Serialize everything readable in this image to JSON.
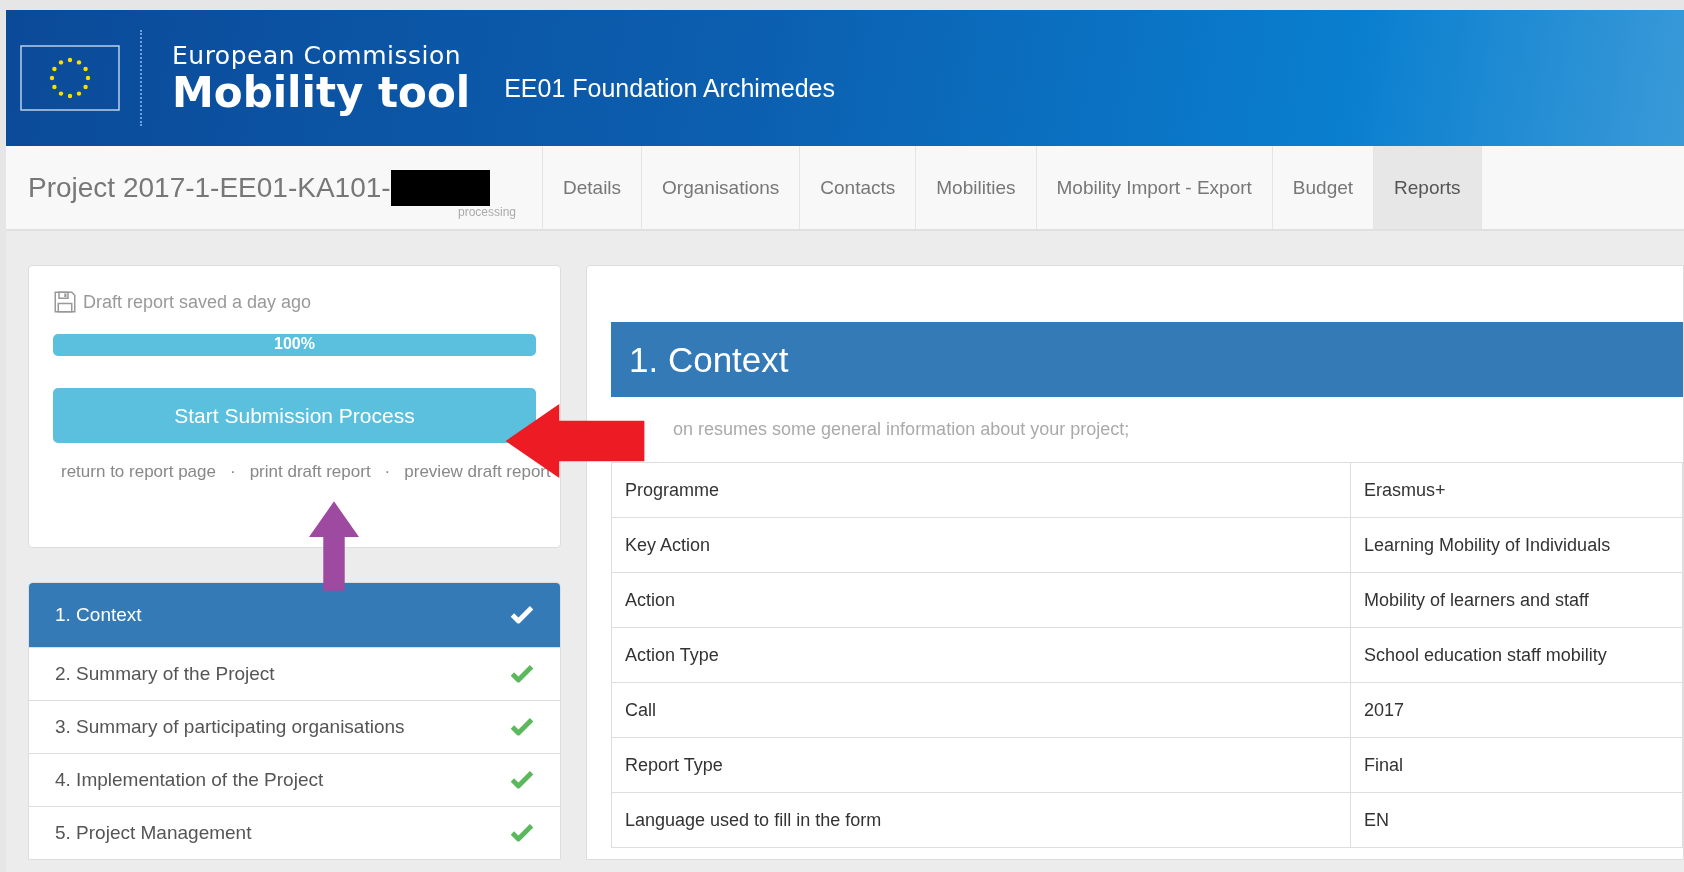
{
  "header": {
    "org_line": "European Commission",
    "app_name": "Mobility tool",
    "organisation": "EE01 Foundation Archimedes"
  },
  "project": {
    "title": "Project 2017-1-EE01-KA101-",
    "status": "processing"
  },
  "tabs": [
    {
      "label": "Details",
      "selected": false
    },
    {
      "label": "Organisations",
      "selected": false
    },
    {
      "label": "Contacts",
      "selected": false
    },
    {
      "label": "Mobilities",
      "selected": false
    },
    {
      "label": "Mobility Import - Export",
      "selected": false
    },
    {
      "label": "Budget",
      "selected": false
    },
    {
      "label": "Reports",
      "selected": true
    }
  ],
  "draft_panel": {
    "saved_text": "Draft report saved a day ago",
    "progress": {
      "level": 1,
      "label": "100%"
    },
    "submit_button": "Start Submission Process",
    "links": [
      "return to report page",
      "print draft report",
      "preview draft report"
    ],
    "separator": "·"
  },
  "sections": [
    {
      "label": "1. Context",
      "selected": true,
      "done": true
    },
    {
      "label": "2. Summary of the Project",
      "selected": false,
      "done": true
    },
    {
      "label": "3. Summary of participating organisations",
      "selected": false,
      "done": true
    },
    {
      "label": "4. Implementation of the Project",
      "selected": false,
      "done": true
    },
    {
      "label": "5. Project Management",
      "selected": false,
      "done": true
    }
  ],
  "content": {
    "heading": "1. Context",
    "intro": "on resumes some general information about your project;",
    "rows": [
      {
        "label": "Programme",
        "value": "Erasmus+"
      },
      {
        "label": "Key Action",
        "value": "Learning Mobility of Individuals"
      },
      {
        "label": "Action",
        "value": "Mobility of learners and staff"
      },
      {
        "label": "Action Type",
        "value": "School education staff mobility"
      },
      {
        "label": "Call",
        "value": "2017"
      },
      {
        "label": "Report Type",
        "value": "Final"
      },
      {
        "label": "Language used to fill in the form",
        "value": "EN"
      }
    ]
  }
}
